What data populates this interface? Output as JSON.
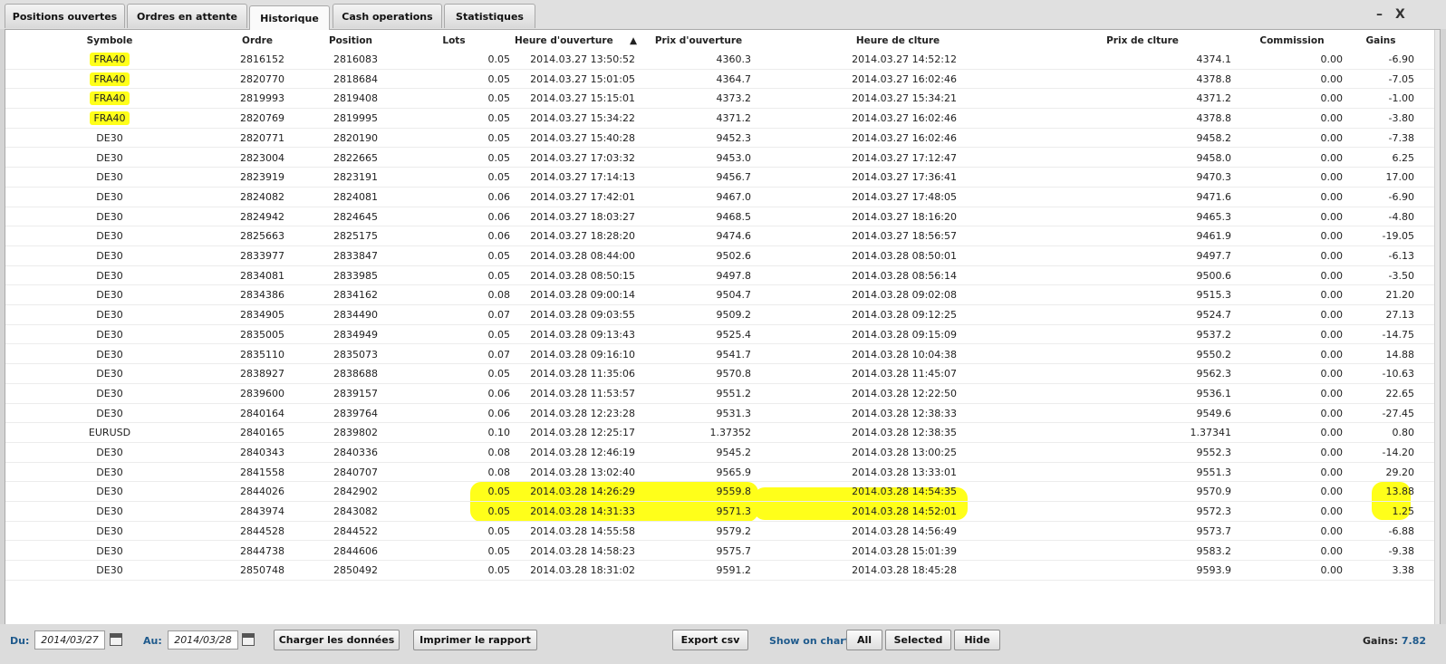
{
  "tabs": [
    {
      "label": "Positions ouvertes"
    },
    {
      "label": "Ordres en attente"
    },
    {
      "label": "Historique"
    },
    {
      "label": "Cash operations"
    },
    {
      "label": "Statistiques"
    }
  ],
  "window": {
    "minimize": "–",
    "close": "X"
  },
  "table": {
    "headers": {
      "symbol": "Symbole",
      "order": "Ordre",
      "position": "Position",
      "lots": "Lots",
      "open_time": "Heure d'ouverture",
      "sort_arrow": "▲",
      "open_price": "Prix d'ouverture",
      "close_time": "Heure de clture",
      "close_price": "Prix de clture",
      "commission": "Commission",
      "gains": "Gains"
    },
    "rows": [
      [
        "FRA40",
        "2816152",
        "2816083",
        "0.05",
        "2014.03.27 13:50:52",
        "4360.3",
        "2014.03.27 14:52:12",
        "4374.1",
        "0.00",
        "-6.90"
      ],
      [
        "FRA40",
        "2820770",
        "2818684",
        "0.05",
        "2014.03.27 15:01:05",
        "4364.7",
        "2014.03.27 16:02:46",
        "4378.8",
        "0.00",
        "-7.05"
      ],
      [
        "FRA40",
        "2819993",
        "2819408",
        "0.05",
        "2014.03.27 15:15:01",
        "4373.2",
        "2014.03.27 15:34:21",
        "4371.2",
        "0.00",
        "-1.00"
      ],
      [
        "FRA40",
        "2820769",
        "2819995",
        "0.05",
        "2014.03.27 15:34:22",
        "4371.2",
        "2014.03.27 16:02:46",
        "4378.8",
        "0.00",
        "-3.80"
      ],
      [
        "DE30",
        "2820771",
        "2820190",
        "0.05",
        "2014.03.27 15:40:28",
        "9452.3",
        "2014.03.27 16:02:46",
        "9458.2",
        "0.00",
        "-7.38"
      ],
      [
        "DE30",
        "2823004",
        "2822665",
        "0.05",
        "2014.03.27 17:03:32",
        "9453.0",
        "2014.03.27 17:12:47",
        "9458.0",
        "0.00",
        "6.25"
      ],
      [
        "DE30",
        "2823919",
        "2823191",
        "0.05",
        "2014.03.27 17:14:13",
        "9456.7",
        "2014.03.27 17:36:41",
        "9470.3",
        "0.00",
        "17.00"
      ],
      [
        "DE30",
        "2824082",
        "2824081",
        "0.06",
        "2014.03.27 17:42:01",
        "9467.0",
        "2014.03.27 17:48:05",
        "9471.6",
        "0.00",
        "-6.90"
      ],
      [
        "DE30",
        "2824942",
        "2824645",
        "0.06",
        "2014.03.27 18:03:27",
        "9468.5",
        "2014.03.27 18:16:20",
        "9465.3",
        "0.00",
        "-4.80"
      ],
      [
        "DE30",
        "2825663",
        "2825175",
        "0.06",
        "2014.03.27 18:28:20",
        "9474.6",
        "2014.03.27 18:56:57",
        "9461.9",
        "0.00",
        "-19.05"
      ],
      [
        "DE30",
        "2833977",
        "2833847",
        "0.05",
        "2014.03.28 08:44:00",
        "9502.6",
        "2014.03.28 08:50:01",
        "9497.7",
        "0.00",
        "-6.13"
      ],
      [
        "DE30",
        "2834081",
        "2833985",
        "0.05",
        "2014.03.28 08:50:15",
        "9497.8",
        "2014.03.28 08:56:14",
        "9500.6",
        "0.00",
        "-3.50"
      ],
      [
        "DE30",
        "2834386",
        "2834162",
        "0.08",
        "2014.03.28 09:00:14",
        "9504.7",
        "2014.03.28 09:02:08",
        "9515.3",
        "0.00",
        "21.20"
      ],
      [
        "DE30",
        "2834905",
        "2834490",
        "0.07",
        "2014.03.28 09:03:55",
        "9509.2",
        "2014.03.28 09:12:25",
        "9524.7",
        "0.00",
        "27.13"
      ],
      [
        "DE30",
        "2835005",
        "2834949",
        "0.05",
        "2014.03.28 09:13:43",
        "9525.4",
        "2014.03.28 09:15:09",
        "9537.2",
        "0.00",
        "-14.75"
      ],
      [
        "DE30",
        "2835110",
        "2835073",
        "0.07",
        "2014.03.28 09:16:10",
        "9541.7",
        "2014.03.28 10:04:38",
        "9550.2",
        "0.00",
        "14.88"
      ],
      [
        "DE30",
        "2838927",
        "2838688",
        "0.05",
        "2014.03.28 11:35:06",
        "9570.8",
        "2014.03.28 11:45:07",
        "9562.3",
        "0.00",
        "-10.63"
      ],
      [
        "DE30",
        "2839600",
        "2839157",
        "0.06",
        "2014.03.28 11:53:57",
        "9551.2",
        "2014.03.28 12:22:50",
        "9536.1",
        "0.00",
        "22.65"
      ],
      [
        "DE30",
        "2840164",
        "2839764",
        "0.06",
        "2014.03.28 12:23:28",
        "9531.3",
        "2014.03.28 12:38:33",
        "9549.6",
        "0.00",
        "-27.45"
      ],
      [
        "EURUSD",
        "2840165",
        "2839802",
        "0.10",
        "2014.03.28 12:25:17",
        "1.37352",
        "2014.03.28 12:38:35",
        "1.37341",
        "0.00",
        "0.80"
      ],
      [
        "DE30",
        "2840343",
        "2840336",
        "0.08",
        "2014.03.28 12:46:19",
        "9545.2",
        "2014.03.28 13:00:25",
        "9552.3",
        "0.00",
        "-14.20"
      ],
      [
        "DE30",
        "2841558",
        "2840707",
        "0.08",
        "2014.03.28 13:02:40",
        "9565.9",
        "2014.03.28 13:33:01",
        "9551.3",
        "0.00",
        "29.20"
      ],
      [
        "DE30",
        "2844026",
        "2842902",
        "0.05",
        "2014.03.28 14:26:29",
        "9559.8",
        "2014.03.28 14:54:35",
        "9570.9",
        "0.00",
        "13.88"
      ],
      [
        "DE30",
        "2843974",
        "2843082",
        "0.05",
        "2014.03.28 14:31:33",
        "9571.3",
        "2014.03.28 14:52:01",
        "9572.3",
        "0.00",
        "1.25"
      ],
      [
        "DE30",
        "2844528",
        "2844522",
        "0.05",
        "2014.03.28 14:55:58",
        "9579.2",
        "2014.03.28 14:56:49",
        "9573.7",
        "0.00",
        "-6.88"
      ],
      [
        "DE30",
        "2844738",
        "2844606",
        "0.05",
        "2014.03.28 14:58:23",
        "9575.7",
        "2014.03.28 15:01:39",
        "9583.2",
        "0.00",
        "-9.38"
      ],
      [
        "DE30",
        "2850748",
        "2850492",
        "0.05",
        "2014.03.28 18:31:02",
        "9591.2",
        "2014.03.28 18:45:28",
        "9593.9",
        "0.00",
        "3.38"
      ]
    ]
  },
  "toolbar": {
    "from_label": "Du:",
    "from_value": "2014/03/27",
    "to_label": "Au:",
    "to_value": "2014/03/28",
    "load_button": "Charger les données",
    "print_button": "Imprimer le rapport",
    "export_button": "Export csv",
    "show_on_chart_label": "Show on chart",
    "all_button": "All",
    "selected_button": "Selected",
    "hide_button": "Hide",
    "gains_label": "Gains:",
    "gains_value": "7.82"
  },
  "colors": {
    "highlight": "#ffff1a",
    "accent": "#1f5a8c"
  }
}
